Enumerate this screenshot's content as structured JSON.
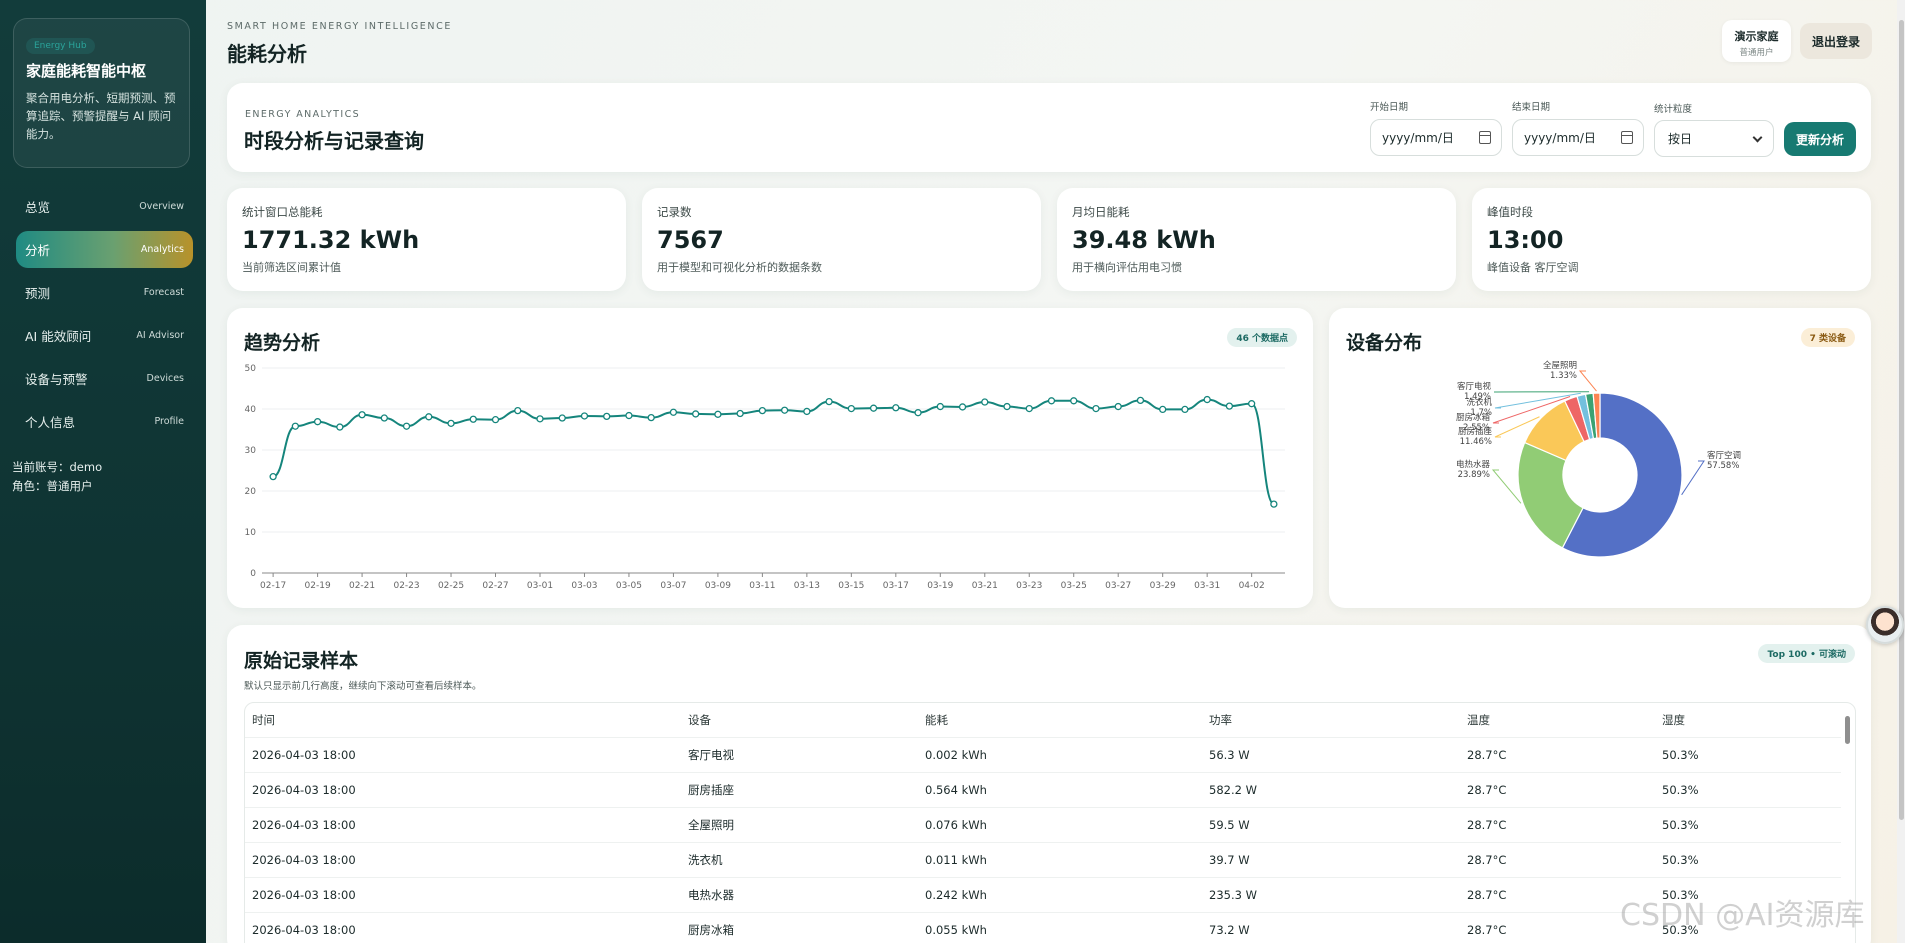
{
  "sidebar": {
    "badge": "Energy Hub",
    "title": "家庭能耗智能中枢",
    "desc": "聚合用电分析、短期预测、预算追踪、预警提醒与 AI 顾问能力。",
    "items": [
      {
        "label": "总览",
        "en": "Overview"
      },
      {
        "label": "分析",
        "en": "Analytics"
      },
      {
        "label": "预测",
        "en": "Forecast"
      },
      {
        "label": "AI 能效顾问",
        "en": "AI Advisor"
      },
      {
        "label": "设备与预警",
        "en": "Devices"
      },
      {
        "label": "个人信息",
        "en": "Profile"
      }
    ],
    "account": "当前账号：demo",
    "role": "角色：普通用户"
  },
  "header": {
    "eyebrow": "SMART HOME ENERGY INTELLIGENCE",
    "title": "能耗分析",
    "user_name": "演示家庭",
    "user_role": "普通用户",
    "logout": "退出登录"
  },
  "filter": {
    "eyebrow": "ENERGY ANALYTICS",
    "title": "时段分析与记录查询",
    "start_label": "开始日期",
    "start_value": "yyyy/mm/日",
    "end_label": "结束日期",
    "end_value": "yyyy/mm/日",
    "granularity_label": "统计粒度",
    "granularity_value": "按日",
    "update": "更新分析"
  },
  "stats": [
    {
      "label": "统计窗口总能耗",
      "value": "1771.32 kWh",
      "sub": "当前筛选区间累计值"
    },
    {
      "label": "记录数",
      "value": "7567",
      "sub": "用于模型和可视化分析的数据条数"
    },
    {
      "label": "月均日能耗",
      "value": "39.48 kWh",
      "sub": "用于横向评估用电习惯"
    },
    {
      "label": "峰值时段",
      "value": "13:00",
      "sub": "峰值设备 客厅空调"
    }
  ],
  "trend": {
    "title": "趋势分析",
    "pill": "46 个数据点"
  },
  "distribution": {
    "title": "设备分布",
    "pill": "7 类设备"
  },
  "chart_data": [
    {
      "type": "line",
      "title": "趋势分析",
      "ylim": [
        0,
        50
      ],
      "yticks": [
        0,
        10,
        20,
        30,
        40,
        50
      ],
      "grid": true,
      "x_tick_labels": [
        "02-17",
        "02-19",
        "02-21",
        "02-23",
        "02-25",
        "02-27",
        "03-01",
        "03-03",
        "03-05",
        "03-07",
        "03-09",
        "03-11",
        "03-13",
        "03-15",
        "03-17",
        "03-19",
        "03-21",
        "03-23",
        "03-25",
        "03-27",
        "03-29",
        "03-31",
        "04-02"
      ],
      "values": [
        23.5,
        35.8,
        36.9,
        35.6,
        38.6,
        37.8,
        35.8,
        38.1,
        36.5,
        37.5,
        37.4,
        39.6,
        37.6,
        37.8,
        38.3,
        38.2,
        38.4,
        37.9,
        39.2,
        38.8,
        38.7,
        38.9,
        39.6,
        39.7,
        39.4,
        41.8,
        40.1,
        40.2,
        40.3,
        39.1,
        40.6,
        40.5,
        41.7,
        40.6,
        40.1,
        42.0,
        42.0,
        40.1,
        40.6,
        42.1,
        39.9,
        39.9,
        42.3,
        40.7,
        41.3,
        16.8
      ],
      "color": "#15857c"
    },
    {
      "type": "pie",
      "title": "设备分布",
      "donut": true,
      "slices": [
        {
          "label": "客厅空调",
          "value": 57.58,
          "color": "#5470c6"
        },
        {
          "label": "电热水器",
          "value": 23.89,
          "color": "#91cc75"
        },
        {
          "label": "厨房插座",
          "value": 11.46,
          "color": "#fac858"
        },
        {
          "label": "厨房冰箱",
          "value": 2.55,
          "color": "#ee6666"
        },
        {
          "label": "洗衣机",
          "value": 1.7,
          "color": "#73c0de"
        },
        {
          "label": "客厅电视",
          "value": 1.49,
          "color": "#3ba272"
        },
        {
          "label": "全屋照明",
          "value": 1.33,
          "color": "#fc8452"
        }
      ]
    }
  ],
  "table": {
    "title": "原始记录样本",
    "sub": "默认只显示前几行高度，继续向下滚动可查看后续样本。",
    "pill": "Top 100 • 可滚动",
    "columns": [
      "时间",
      "设备",
      "能耗",
      "功率",
      "温度",
      "湿度"
    ],
    "rows": [
      [
        "2026-04-03 18:00",
        "客厅电视",
        "0.002 kWh",
        "56.3 W",
        "28.7°C",
        "50.3%"
      ],
      [
        "2026-04-03 18:00",
        "厨房插座",
        "0.564 kWh",
        "582.2 W",
        "28.7°C",
        "50.3%"
      ],
      [
        "2026-04-03 18:00",
        "全屋照明",
        "0.076 kWh",
        "59.5 W",
        "28.7°C",
        "50.3%"
      ],
      [
        "2026-04-03 18:00",
        "洗衣机",
        "0.011 kWh",
        "39.7 W",
        "28.7°C",
        "50.3%"
      ],
      [
        "2026-04-03 18:00",
        "电热水器",
        "0.242 kWh",
        "235.3 W",
        "28.7°C",
        "50.3%"
      ],
      [
        "2026-04-03 18:00",
        "厨房冰箱",
        "0.055 kWh",
        "73.2 W",
        "28.7°C",
        "50.3%"
      ]
    ]
  },
  "watermark": "CSDN @AI资源库"
}
